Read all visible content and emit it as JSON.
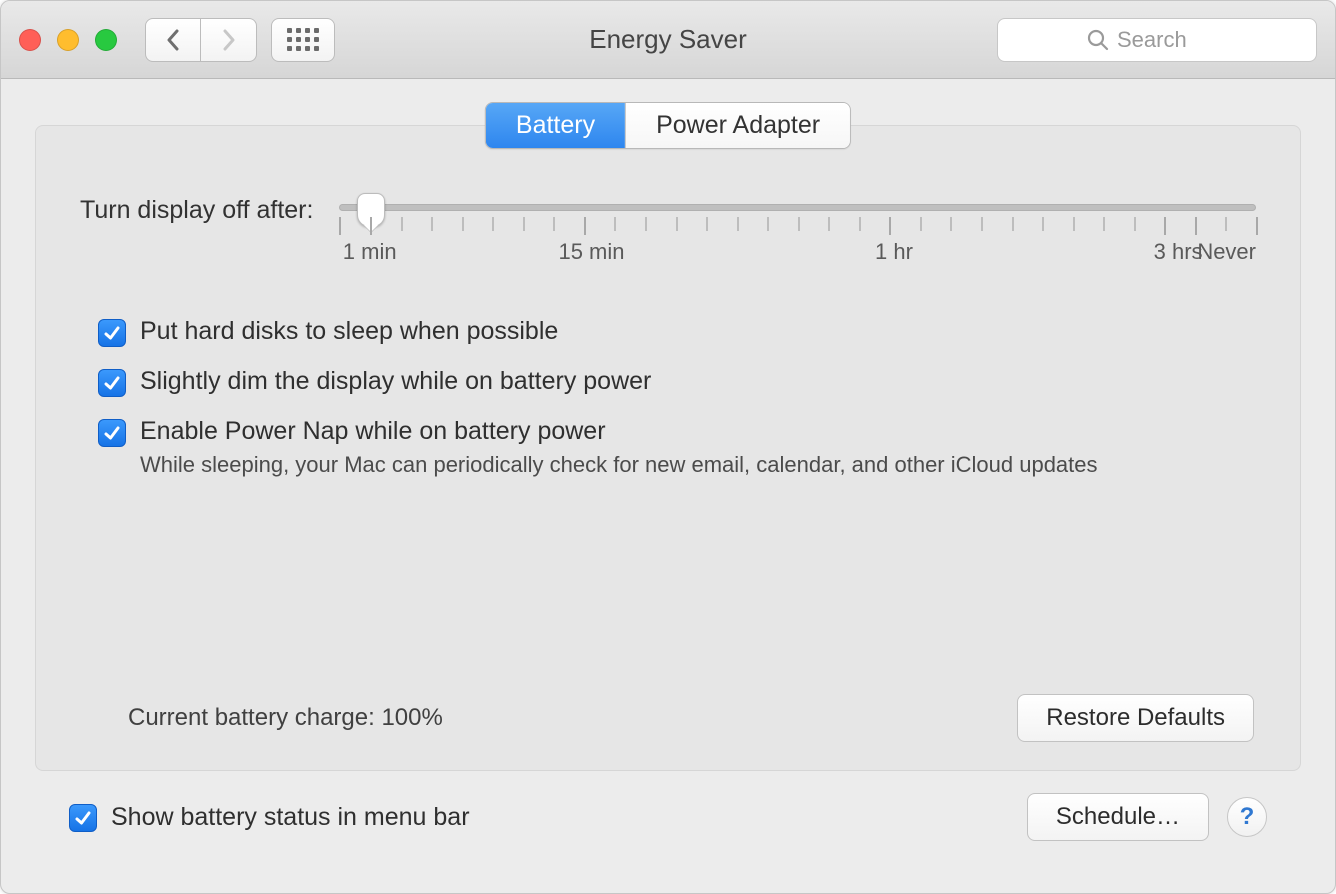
{
  "window": {
    "title": "Energy Saver",
    "search_placeholder": "Search"
  },
  "tabs": {
    "battery": "Battery",
    "power_adapter": "Power Adapter",
    "active": "battery"
  },
  "slider": {
    "label": "Turn display off after:",
    "labels": {
      "min1": "1 min",
      "min15": "15 min",
      "hr1": "1 hr",
      "hr3": "3 hrs",
      "never": "Never"
    }
  },
  "checks": {
    "hard_disks": "Put hard disks to sleep when possible",
    "dim_display": "Slightly dim the display while on battery power",
    "power_nap": "Enable Power Nap while on battery power",
    "power_nap_desc": "While sleeping, your Mac can periodically check for new email, calendar, and other iCloud updates"
  },
  "footer": {
    "charge": "Current battery charge: 100%",
    "restore_defaults": "Restore Defaults"
  },
  "bottom": {
    "show_battery": "Show battery status in menu bar",
    "schedule": "Schedule…",
    "help": "?"
  }
}
